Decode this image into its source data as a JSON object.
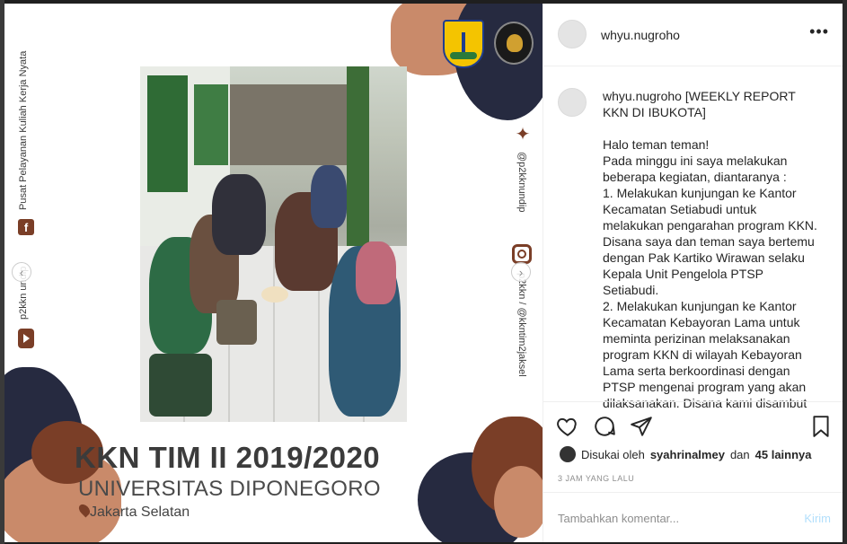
{
  "post_image": {
    "side_left_org": "Pusat Pelayanan Kuliah Kerja Nyata",
    "side_left_handle": "p2kkn undip",
    "side_right_twitter": "@p2kknundip",
    "side_right_instagram": "p2kkn / @kkntim2jaksel",
    "title_line1": "KKN TIM II 2019/2020",
    "title_line2": "UNIVERSITAS DIPONEGORO",
    "title_line3": "Jakarta Selatan",
    "colors": {
      "brown": "#7a3e27",
      "navy": "#262a40",
      "peach": "#c98a6a"
    }
  },
  "header": {
    "username": "whyu.nugroho",
    "more_label": "•••"
  },
  "caption": {
    "author": "whyu.nugroho",
    "title": "[WEEKLY REPORT KKN DI IBUKOTA]",
    "body": "Halo teman teman!\nPada minggu ini saya melakukan beberapa kegiatan, diantaranya :\n1. Melakukan kunjungan ke Kantor Kecamatan Setiabudi untuk melakukan pengarahan program KKN. Disana saya dan teman saya bertemu dengan Pak Kartiko Wirawan selaku Kepala Unit Pengelola PTSP Setiabudi.\n2. Melakukan kunjungan ke Kantor Kecamatan Kebayoran Lama untuk meminta perizinan melaksanakan program KKN di wilayah Kebayoran Lama serta berkoordinasi dengan PTSP mengenai program yang akan dilaksanakan. Disana kami disambut"
  },
  "actions": {
    "icons": [
      "heart-icon",
      "comment-icon",
      "share-icon",
      "bookmark-icon"
    ]
  },
  "likes": {
    "prefix": "Disukai oleh",
    "user": "syahrinalmey",
    "connector": "dan",
    "others": "45 lainnya"
  },
  "timestamp": "3 JAM YANG LALU",
  "comment": {
    "placeholder": "Tambahkan komentar...",
    "submit_label": "Kirim"
  }
}
